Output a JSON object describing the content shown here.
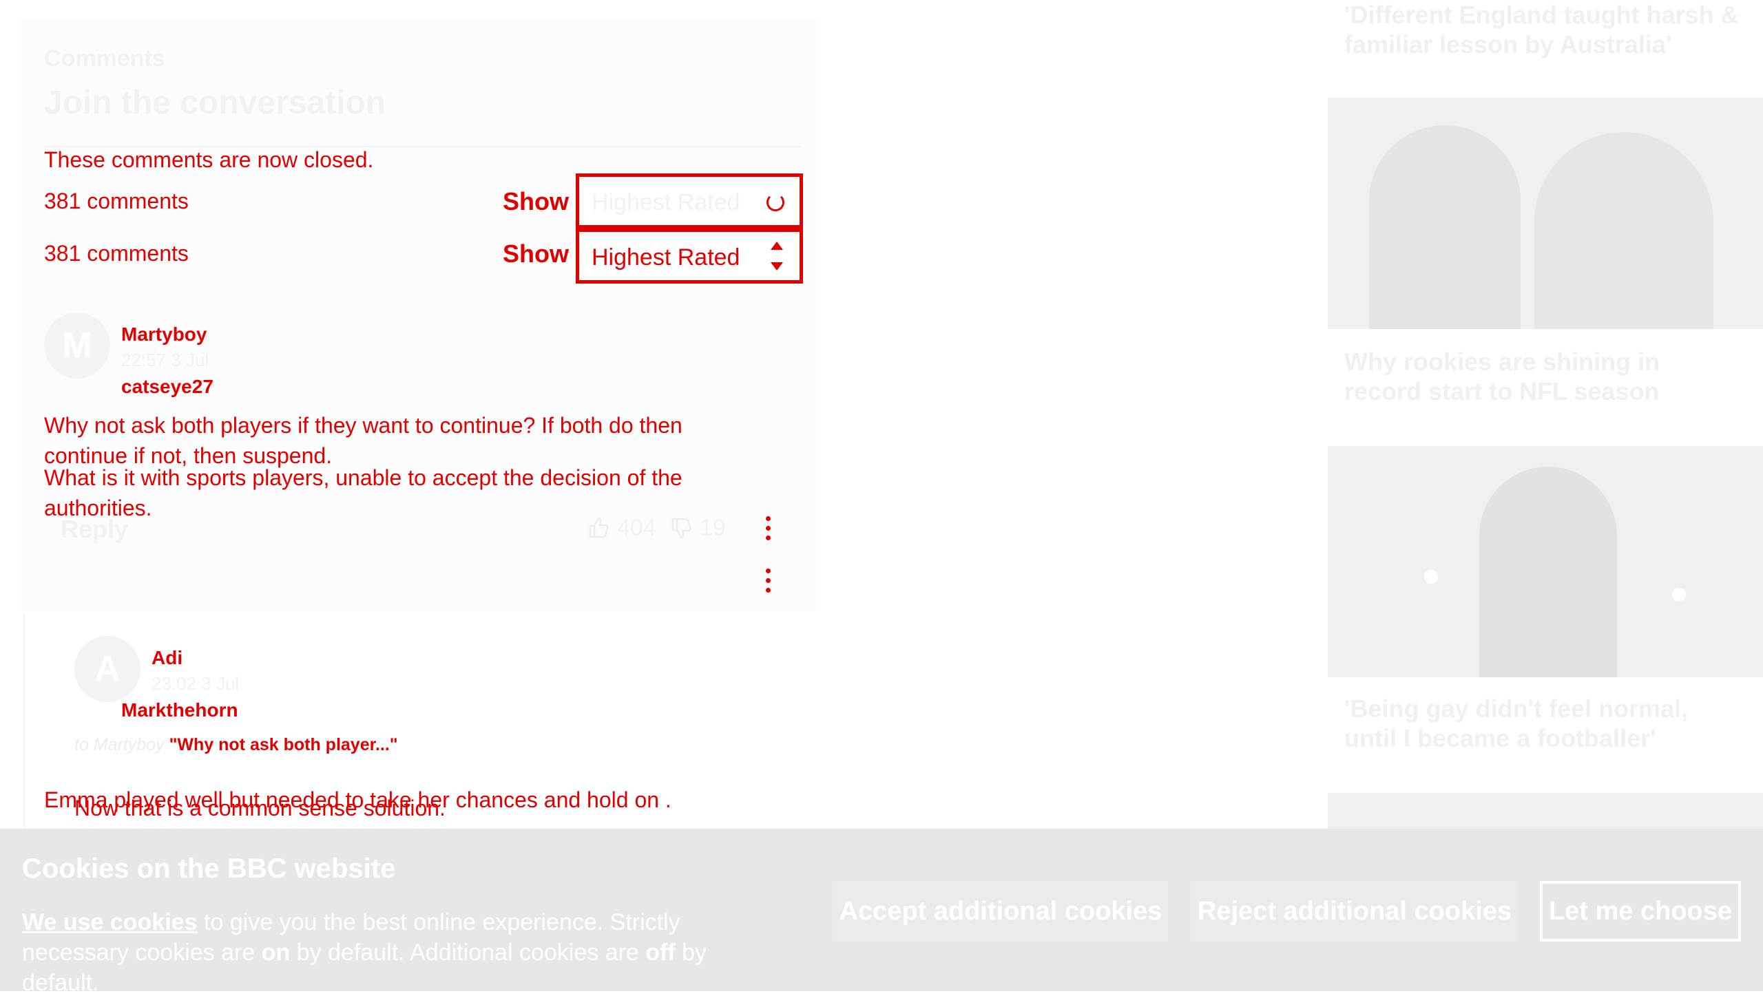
{
  "comments": {
    "heading_small": "Comments",
    "heading": "Join the conversation",
    "closed_notice": "These comments are now closed.",
    "count_text": "381 comments",
    "show_label": "Show",
    "sort_value": "Highest Rated"
  },
  "thread": [
    {
      "avatar_letter": "M",
      "author": "Martyboy",
      "timestamp": "22:57 3 Jul",
      "overlay_author": "catseye27",
      "body": "Why not ask both players if they want to continue? If both do then continue if not, then suspend.",
      "overlay_body": "What is it with sports players, unable to accept the decision of the authorities.",
      "reply_label": "Reply",
      "likes": "404",
      "dislikes": "19"
    }
  ],
  "replies": [
    {
      "avatar_letter": "A",
      "author": "Adi",
      "timestamp": "23:02 3 Jul",
      "overlay_author": "Markthehorn",
      "reply_to_prefix": "to Martyboy",
      "quote": "\"Why not ask both player...\"",
      "body": "Now that is a common sense solution.",
      "overlay_body": "Emma played well but needed to take her chances and hold on ."
    }
  ],
  "sidebar": {
    "headlines": [
      "'Different England taught harsh & familiar lesson by Australia'",
      "Why rookies are shining in record start to NFL season",
      "'Being gay didn't feel normal, until I became a footballer'"
    ]
  },
  "cookies": {
    "title": "Cookies on the BBC website",
    "link_text": "We use cookies",
    "text_1": " to give you the best online experience. Strictly necessary cookies are ",
    "on_word": "on",
    "text_2": " by default. Additional cookies are ",
    "off_word": "off",
    "text_3": " by default.",
    "accept_label": "Accept additional cookies",
    "reject_label": "Reject additional cookies",
    "choose_label": "Let me choose"
  },
  "colors": {
    "accent": "#e00000",
    "banner_bg": "#e7e7e7",
    "faded": "#f1f1f1"
  }
}
